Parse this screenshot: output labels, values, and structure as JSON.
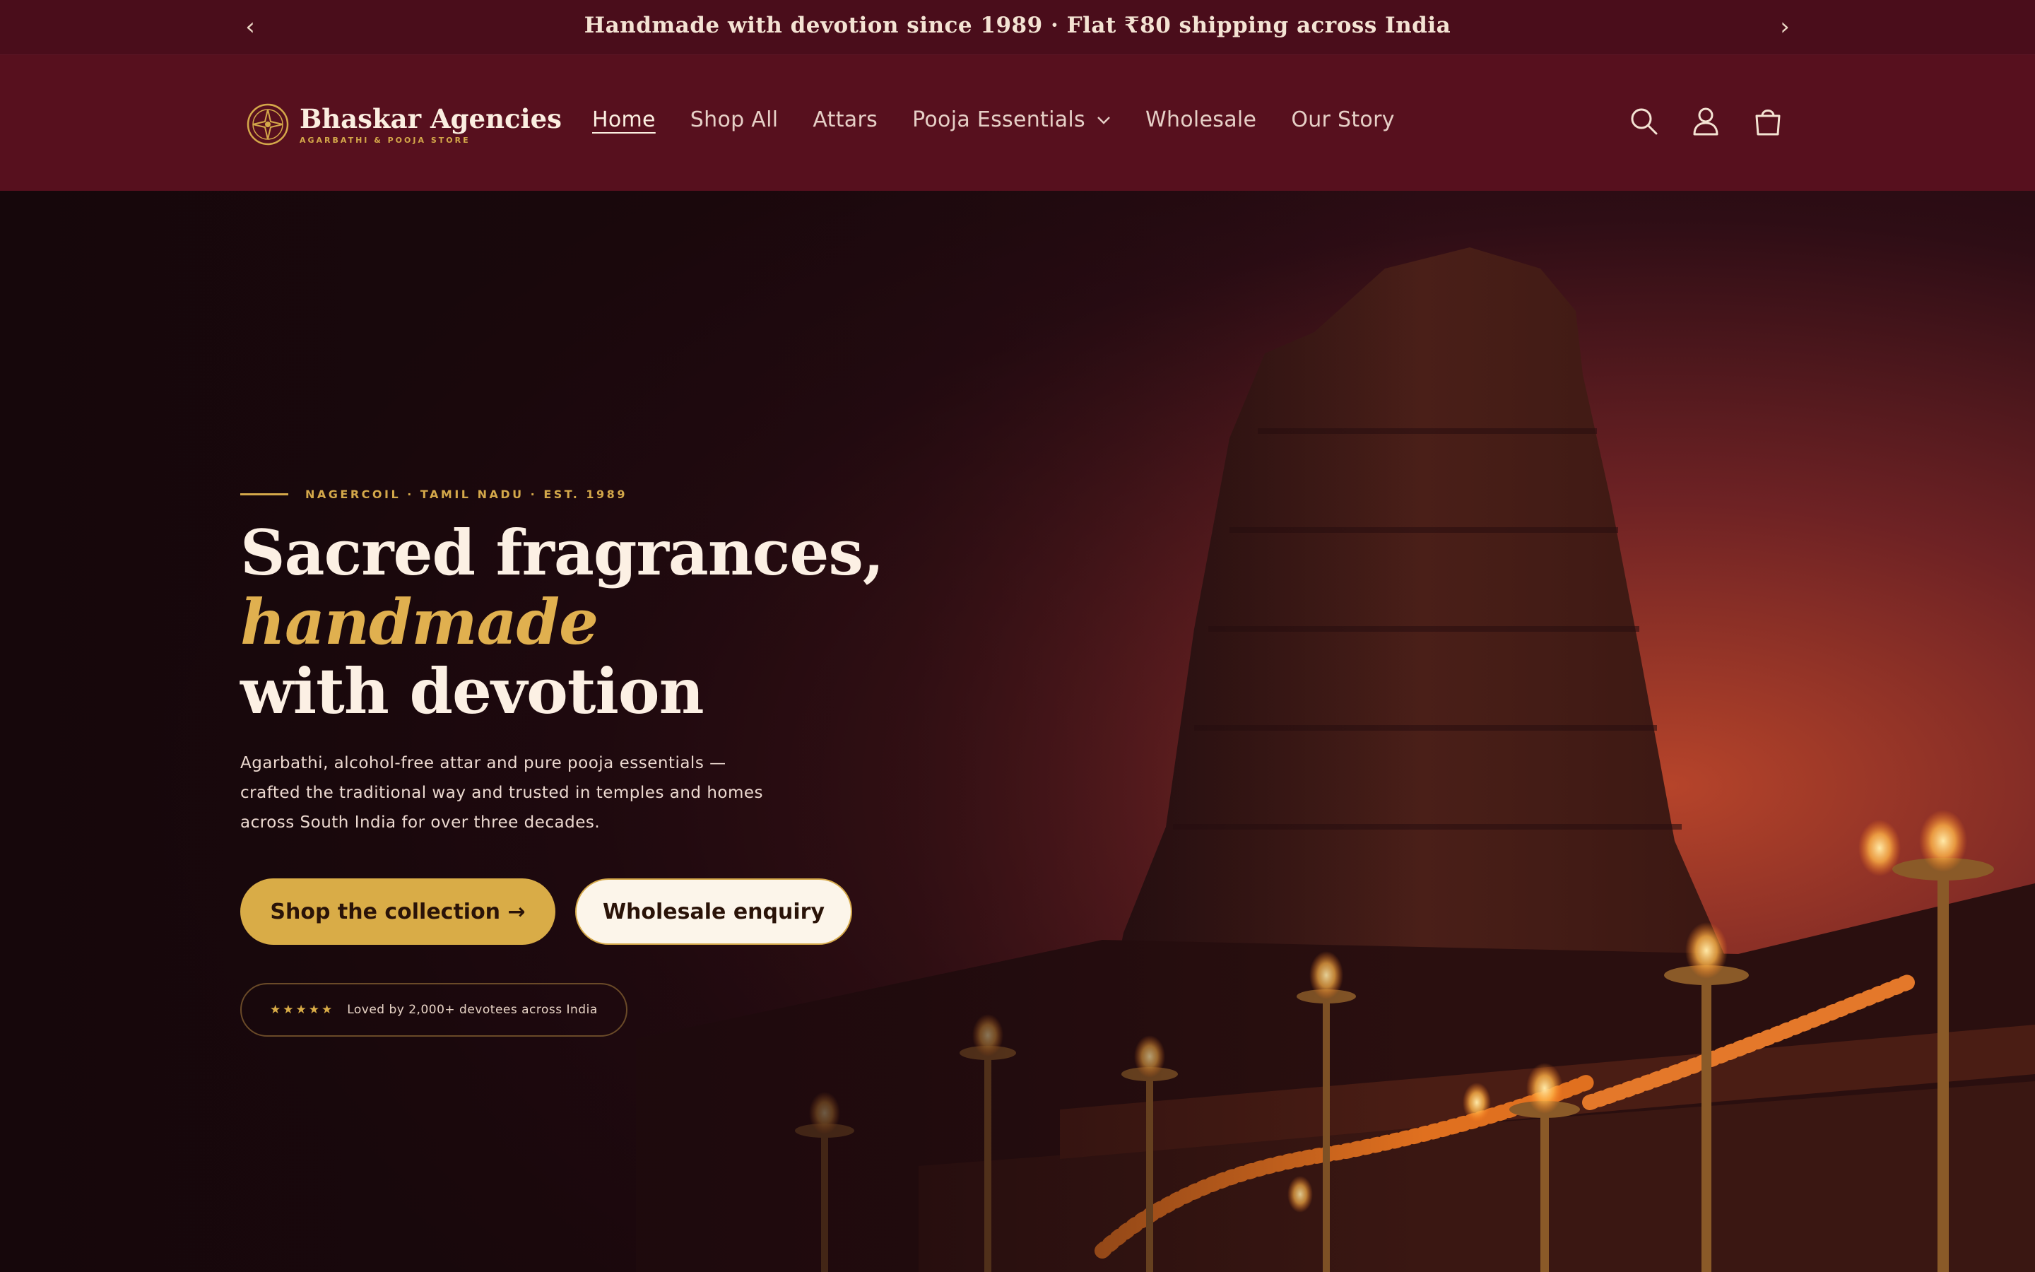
{
  "announcement": {
    "text": "Handmade with devotion since 1989 · Flat ₹80 shipping across India",
    "prev_icon": "chevron-left-icon",
    "next_icon": "chevron-right-icon"
  },
  "brand": {
    "name": "Bhaskar Agencies",
    "tagline": "AGARBATHI & POOJA STORE"
  },
  "nav": {
    "items": [
      {
        "label": "Home",
        "active": true
      },
      {
        "label": "Shop All"
      },
      {
        "label": "Attars"
      },
      {
        "label": "Pooja Essentials",
        "has_dropdown": true
      },
      {
        "label": "Wholesale"
      },
      {
        "label": "Our Story"
      }
    ]
  },
  "header_icons": [
    "search-icon",
    "account-icon",
    "cart-icon"
  ],
  "hero": {
    "eyebrow": "NAGERCOIL · TAMIL NADU · EST. 1989",
    "headline_part1": "Sacred fragrances, ",
    "headline_accent": "handmade",
    "headline_part2": "with devotion",
    "subtext": "Agarbathi, alcohol-free attar and pure pooja essentials — crafted the traditional way and trusted in temples and homes across South India for over three decades.",
    "primary_cta": "Shop the collection →",
    "secondary_cta": "Wholesale enquiry",
    "rating_stars": "★★★★★",
    "rating_text": "Loved by 2,000+ devotees across India"
  },
  "colors": {
    "announcement_bg": "#4a0d1b",
    "header_bg": "#57101e",
    "gold_accent": "#d9ac47",
    "cream": "#fcf5ea"
  }
}
